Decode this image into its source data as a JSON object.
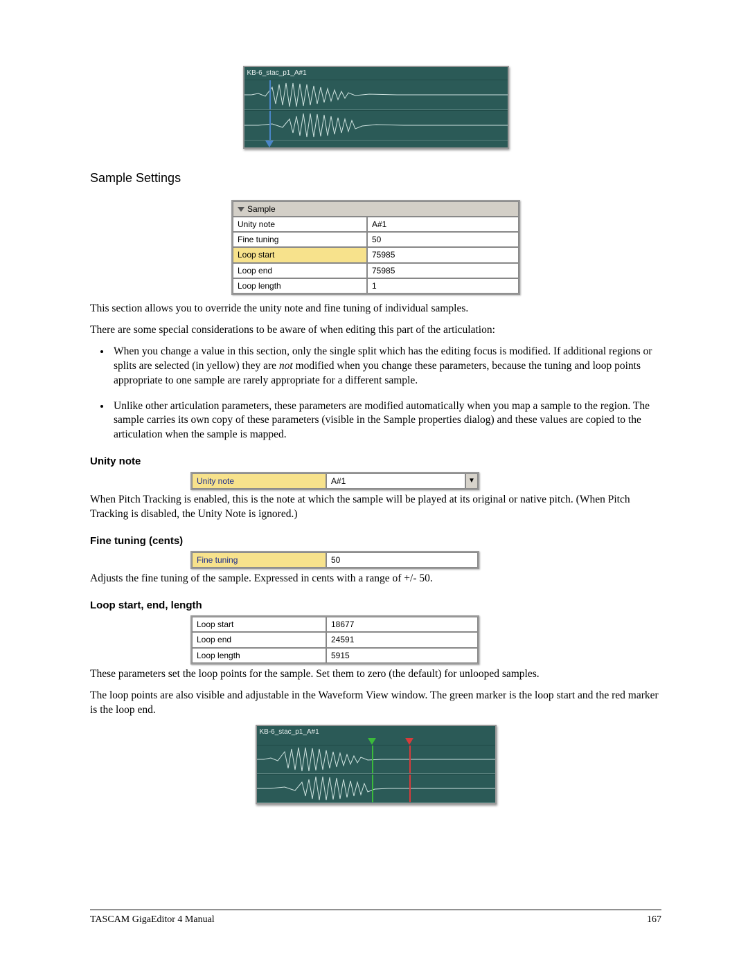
{
  "waveform1": {
    "label": "KB-6_stac_p1_A#1"
  },
  "section_heading": "Sample Settings",
  "sample_table": {
    "header": "Sample",
    "rows": [
      {
        "label": "Unity note",
        "value": "A#1",
        "hi": false
      },
      {
        "label": "Fine tuning",
        "value": "50",
        "hi": false
      },
      {
        "label": "Loop start",
        "value": "75985",
        "hi": true
      },
      {
        "label": "Loop end",
        "value": "75985",
        "hi": false
      },
      {
        "label": "Loop length",
        "value": "1",
        "hi": false
      }
    ]
  },
  "para1": "This section allows you to override the unity note and fine tuning of individual samples.",
  "para2": "There are some special considerations to be aware of when editing this part of the articulation:",
  "bullets": [
    {
      "pre": "When you change a value in this section, only the single split which has the editing focus is modified.  If additional regions or splits are selected (in yellow) they are ",
      "em": "not",
      "post": " modified when you change these parameters, because the tuning and loop points appropriate to one sample are rarely appropriate for a different sample."
    },
    {
      "pre": "Unlike other articulation parameters, these parameters are modified automatically when you map a sample to the region.  The sample carries its own copy of these parameters (visible in the Sample properties dialog) and these values are copied to the articulation when the sample is mapped.",
      "em": "",
      "post": ""
    }
  ],
  "unity": {
    "heading": "Unity note",
    "row": {
      "label": "Unity note",
      "value": "A#1"
    },
    "para": "When Pitch Tracking is enabled, this is the note at which the sample will be played at its original or native pitch.  (When Pitch Tracking is disabled, the Unity Note is ignored.)"
  },
  "fine": {
    "heading": "Fine tuning (cents)",
    "row": {
      "label": "Fine tuning",
      "value": "50"
    },
    "para": "Adjusts the fine tuning of the sample.  Expressed in cents with a range of +/- 50."
  },
  "loop": {
    "heading": "Loop start, end, length",
    "rows": [
      {
        "label": "Loop start",
        "value": "18677"
      },
      {
        "label": "Loop end",
        "value": "24591"
      },
      {
        "label": "Loop length",
        "value": "5915"
      }
    ],
    "para1": "These parameters set the loop points for the sample.  Set them to zero (the default) for unlooped samples.",
    "para2": "The loop points are also visible and adjustable in the Waveform View window.  The green marker is the loop start and the red marker is the loop end."
  },
  "waveform2": {
    "label": "KB-6_stac_p1_A#1"
  },
  "footer": {
    "left": "TASCAM GigaEditor 4 Manual",
    "right": "167"
  }
}
